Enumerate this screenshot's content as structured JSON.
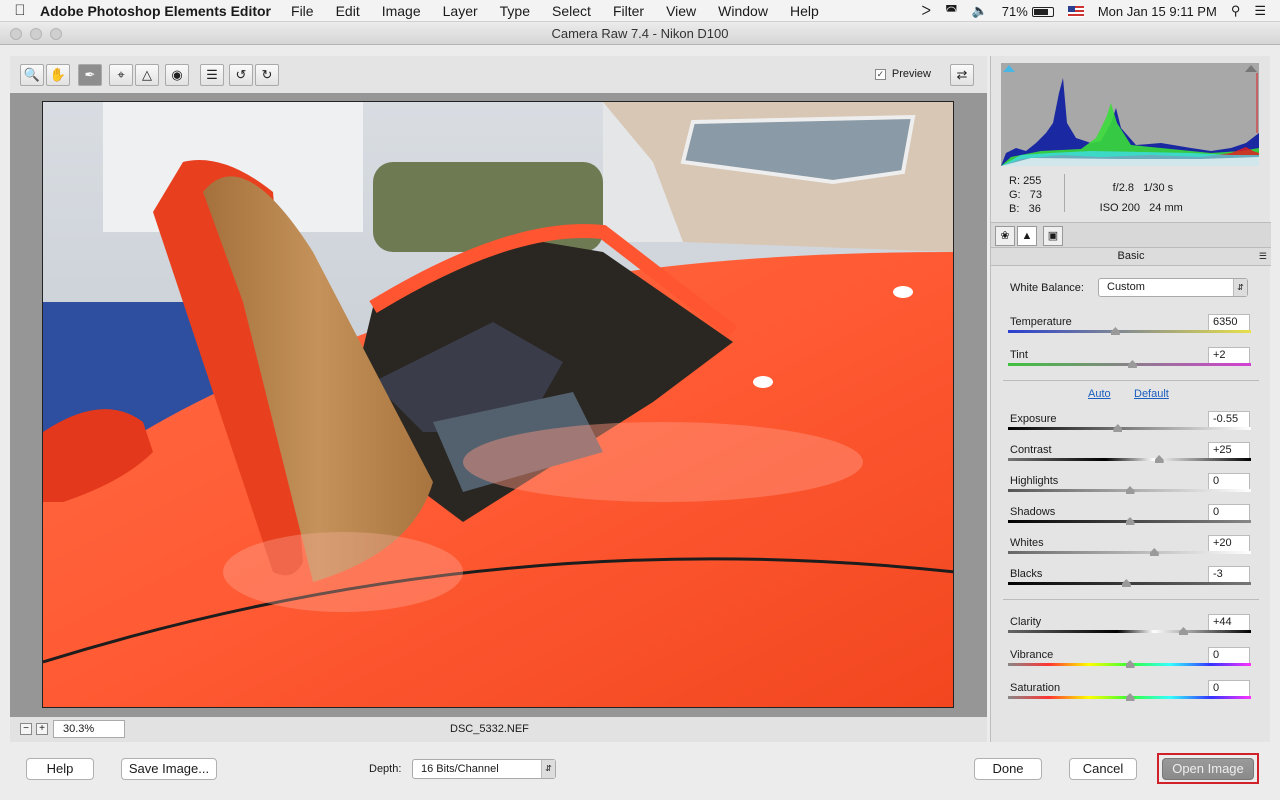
{
  "menubar": {
    "app_name": "Adobe Photoshop Elements Editor",
    "menus": [
      "File",
      "Edit",
      "Image",
      "Layer",
      "Type",
      "Select",
      "Filter",
      "View",
      "Window",
      "Help"
    ],
    "battery": "71%",
    "datetime": "Mon Jan 15  9:11 PM"
  },
  "window": {
    "title": "Camera Raw 7.4  -  Nikon D100"
  },
  "toolbar": {
    "preview_label": "Preview",
    "preview_checked": true,
    "tools": [
      "zoom-tool",
      "hand-tool",
      "white-balance-tool",
      "crop-tool",
      "straighten-tool",
      "red-eye-tool",
      "preferences",
      "rotate-left",
      "rotate-right"
    ]
  },
  "status": {
    "zoom": "30.3%",
    "filename": "DSC_5332.NEF"
  },
  "readout": {
    "r_label": "R:",
    "r": "255",
    "g_label": "G:",
    "g": "73",
    "b_label": "B:",
    "b": "36",
    "aperture": "f/2.8",
    "shutter": "1/30 s",
    "iso": "ISO 200",
    "focal": "24 mm"
  },
  "panel": {
    "section": "Basic",
    "white_balance_label": "White Balance:",
    "white_balance_value": "Custom",
    "auto_label": "Auto",
    "default_label": "Default",
    "sliders": [
      {
        "label": "Temperature",
        "value": "6350",
        "pos": 0.44
      },
      {
        "label": "Tint",
        "value": "+2",
        "pos": 0.51
      },
      {
        "label": "Exposure",
        "value": "-0.55",
        "pos": 0.45
      },
      {
        "label": "Contrast",
        "value": "+25",
        "pos": 0.62
      },
      {
        "label": "Highlights",
        "value": "0",
        "pos": 0.5
      },
      {
        "label": "Shadows",
        "value": "0",
        "pos": 0.5
      },
      {
        "label": "Whites",
        "value": "+20",
        "pos": 0.6
      },
      {
        "label": "Blacks",
        "value": "-3",
        "pos": 0.485
      },
      {
        "label": "Clarity",
        "value": "+44",
        "pos": 0.72
      },
      {
        "label": "Vibrance",
        "value": "0",
        "pos": 0.5
      },
      {
        "label": "Saturation",
        "value": "0",
        "pos": 0.5
      }
    ]
  },
  "bottom": {
    "help": "Help",
    "save_image": "Save Image...",
    "depth_label": "Depth:",
    "depth_value": "16 Bits/Channel",
    "done": "Done",
    "cancel": "Cancel",
    "open_image": "Open Image"
  },
  "colors": {
    "accent_highlight": "#d0202a",
    "link": "#1a5fc0"
  }
}
